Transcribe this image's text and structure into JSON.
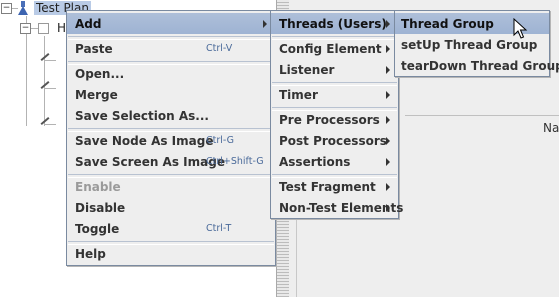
{
  "tree": {
    "root_label": "Test Plan",
    "child_label_fragment": "H"
  },
  "right_panel": {
    "field_label_fragment": "Na"
  },
  "main_menu": {
    "items": [
      {
        "label": "Add",
        "submenu": true,
        "selected": true
      },
      {
        "label": "Paste",
        "accelerator": "Ctrl-V"
      },
      {
        "label": "Open..."
      },
      {
        "label": "Merge"
      },
      {
        "label": "Save Selection As..."
      },
      {
        "label": "Save Node As Image",
        "accelerator": "Ctrl-G"
      },
      {
        "label": "Save Screen As Image",
        "accelerator": "Ctrl+Shift-G"
      },
      {
        "label": "Enable",
        "disabled": true
      },
      {
        "label": "Disable"
      },
      {
        "label": "Toggle",
        "accelerator": "Ctrl-T"
      },
      {
        "label": "Help"
      }
    ]
  },
  "add_menu": {
    "items": [
      {
        "label": "Threads (Users)",
        "submenu": true,
        "selected": true
      },
      {
        "label": "Config Element",
        "submenu": true
      },
      {
        "label": "Listener",
        "submenu": true
      },
      {
        "label": "Timer",
        "submenu": true
      },
      {
        "label": "Pre Processors",
        "submenu": true
      },
      {
        "label": "Post Processors",
        "submenu": true
      },
      {
        "label": "Assertions",
        "submenu": true
      },
      {
        "label": "Test Fragment",
        "submenu": true
      },
      {
        "label": "Non-Test Elements",
        "submenu": true
      }
    ]
  },
  "threads_menu": {
    "items": [
      {
        "label": "Thread Group",
        "selected": true
      },
      {
        "label": "setUp Thread Group"
      },
      {
        "label": "tearDown Thread Group"
      }
    ]
  },
  "colors": {
    "menu_bg": "#eeeeee",
    "selection": "#a8bbd8",
    "accelerator": "#4a6a9a",
    "disabled": "#9a9a9a"
  }
}
